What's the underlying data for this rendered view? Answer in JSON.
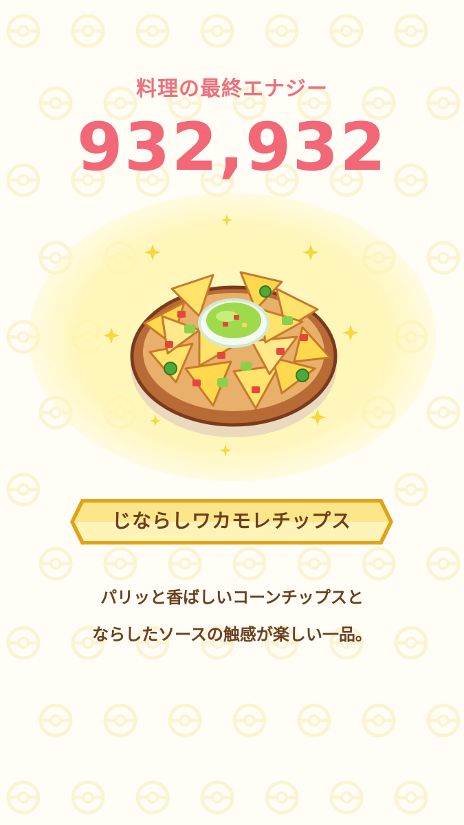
{
  "result": {
    "title": "料理の最終エナジー",
    "energy": "932,932"
  },
  "dish": {
    "name": "じならしワカモレチップス",
    "image_icon": "nachos-guacamole-dish-icon",
    "description_lines": [
      "パリッと香ばしいコーンチップスと",
      "ならしたソースの触感が楽しい一品。"
    ]
  },
  "colors": {
    "title": "#ee6f7c",
    "energy": "#f26877",
    "banner_fill": "#fde68a",
    "banner_border": "#e0a318",
    "text_brown": "#6b3f1e",
    "background": "#fffdf6"
  }
}
